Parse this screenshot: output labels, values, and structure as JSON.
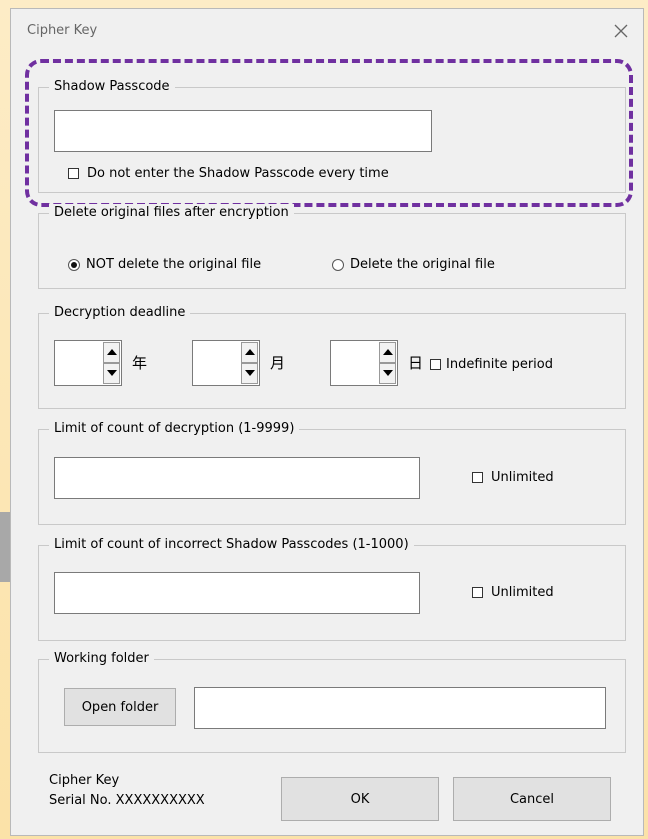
{
  "dialog": {
    "title": "Cipher Key"
  },
  "shadow": {
    "legend": "Shadow Passcode",
    "input_value": "",
    "checkbox_label": "Do not enter the Shadow Passcode every time",
    "checked": false
  },
  "delete": {
    "legend": "Delete original files after encryption",
    "option_not_delete": "NOT delete the original file",
    "option_delete": "Delete the original file",
    "selected": "NOT delete the original file"
  },
  "deadline": {
    "legend": "Decryption deadline",
    "year_value": "",
    "month_value": "",
    "day_value": "",
    "year_unit": "年",
    "month_unit": "月",
    "day_unit": "日",
    "indefinite_label": "Indefinite period",
    "indefinite_checked": false
  },
  "decrypt_limit": {
    "legend": "Limit of count of decryption (1-9999)",
    "input_value": "",
    "unlimited_label": "Unlimited",
    "unlimited_checked": false
  },
  "incorrect_limit": {
    "legend": "Limit of count of incorrect  Shadow Passcodes (1-1000)",
    "input_value": "",
    "unlimited_label": "Unlimited",
    "unlimited_checked": false
  },
  "working": {
    "legend": "Working folder",
    "open_button": "Open folder",
    "path_value": ""
  },
  "footer": {
    "product": "Cipher Key",
    "serial": "Serial No. XXXXXXXXXX",
    "ok": "OK",
    "cancel": "Cancel"
  },
  "colors": {
    "highlight": "#7030a0",
    "background": "#fbe2a8",
    "dialog": "#f0f0f0"
  }
}
